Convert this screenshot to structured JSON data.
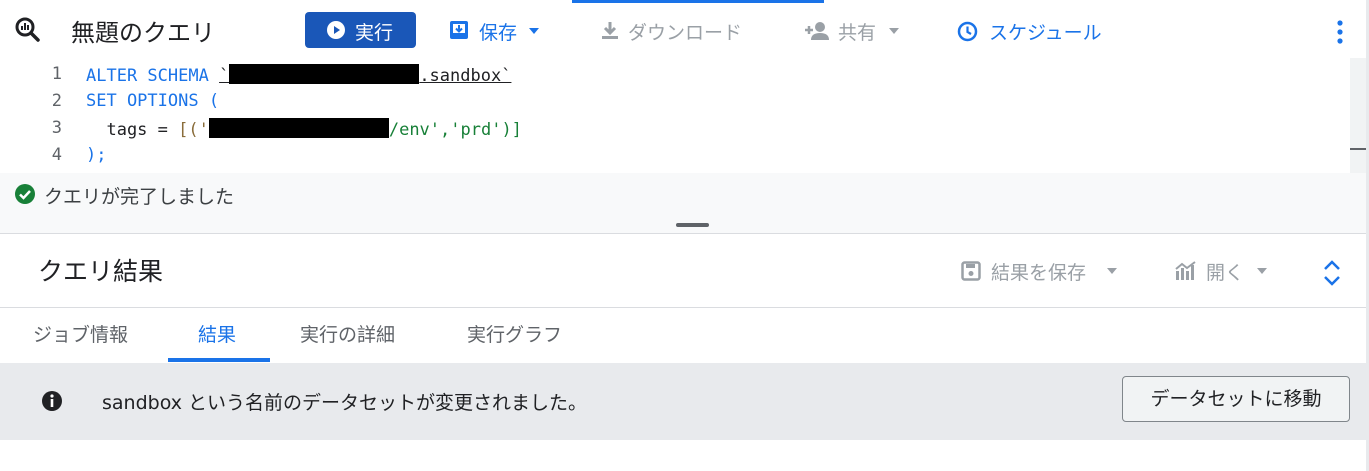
{
  "toolbar": {
    "title": "無題のクエリ",
    "run_label": "実行",
    "save_label": "保存",
    "download_label": "ダウンロード",
    "share_label": "共有",
    "schedule_label": "スケジュール"
  },
  "editor": {
    "line_numbers": [
      "1",
      "2",
      "3",
      "4"
    ],
    "line1_kw": "ALTER SCHEMA ",
    "line1_tick_open": "`",
    "line1_tail": ".sandbox`",
    "line2": "SET OPTIONS (",
    "line3_prefix": "  tags = ",
    "line3_bracket": "[('",
    "line3_str_open": "'",
    "line3_str_tail": "/env','prd'",
    "line3_close": ")]",
    "line4": ");"
  },
  "status": {
    "message": "クエリが完了しました"
  },
  "results": {
    "title": "クエリ結果",
    "save_results_label": "結果を保存",
    "open_label": "開く"
  },
  "tabs": [
    {
      "label": "ジョブ情報"
    },
    {
      "label": "結果"
    },
    {
      "label": "実行の詳細"
    },
    {
      "label": "実行グラフ"
    }
  ],
  "banner": {
    "message": "sandbox という名前のデータセットが変更されました。",
    "button_label": "データセットに移動"
  },
  "colors": {
    "primary": "#1a73e8",
    "run_button": "#1a57b8",
    "success": "#188038"
  },
  "icons": {
    "app": "bigquery-icon",
    "run": "play-circle-icon",
    "save": "save-icon",
    "download": "download-icon",
    "share": "person-add-icon",
    "schedule": "clock-icon",
    "more": "more-vert-icon",
    "status": "check-circle-icon",
    "save_results": "floppy-icon",
    "open": "chart-icon",
    "expand": "expand-icon",
    "info": "info-icon"
  }
}
